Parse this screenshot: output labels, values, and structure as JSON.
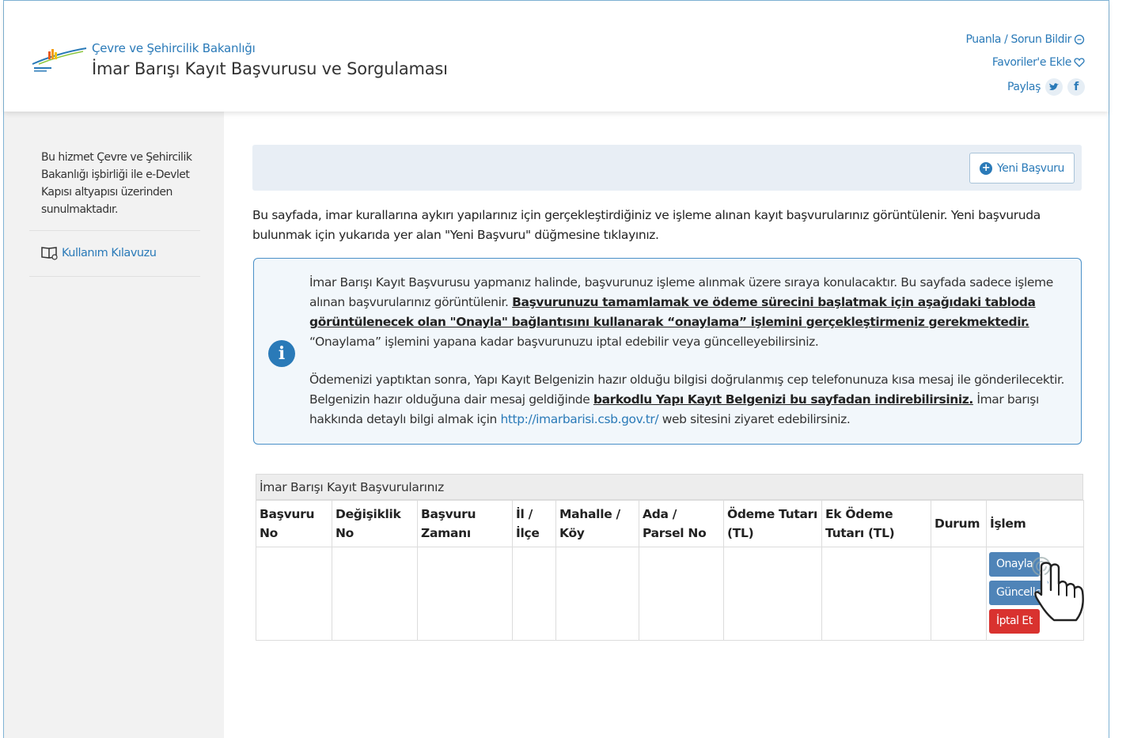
{
  "header": {
    "ministry": "Çevre ve Şehircilik Bakanlığı",
    "service_title": "İmar Barışı Kayıt Başvurusu ve Sorgulaması",
    "rate_link": "Puanla / Sorun Bildir",
    "favorites_link": "Favoriler'e Ekle",
    "share_label": "Paylaş",
    "logo_icon": "ministry-logo",
    "colors": {
      "accent": "#2a7ab8",
      "danger": "#d9322f",
      "action": "#4f84b8"
    }
  },
  "sidebar": {
    "description": "Bu hizmet Çevre ve Şehircilik Bakanlığı işbirliği ile e-Devlet Kapısı altyapısı üzerinden sunulmaktadır.",
    "guide_link": "Kullanım Kılavuzu"
  },
  "toolbar": {
    "new_application": "Yeni Başvuru"
  },
  "intro": "Bu sayfada, imar kurallarına aykırı yapılarınız için gerçekleştirdiğiniz ve işleme alınan kayıt başvurularınız görüntülenir. Yeni başvuruda bulunmak için yukarıda yer alan \"Yeni Başvuru\" düğmesine tıklayınız.",
  "info": {
    "p1_a": "İmar Barışı Kayıt Başvurusu yapmanız halinde, başvurunuz işleme alınmak üzere sıraya konulacaktır. Bu sayfada sadece işleme alınan başvurularınız görüntülenir. ",
    "p1_bold": "Başvurunuzu tamamlamak ve ödeme sürecini başlatmak için aşağıdaki tabloda görüntülenecek olan \"Onayla\" bağlantısını kullanarak “onaylama” işlemini gerçekleştirmeniz gerekmektedir.",
    "p1_c": " “Onaylama” işlemini yapana kadar başvurunuzu iptal edebilir veya güncelleyebilirsiniz.",
    "p2_a": "Ödemenizi yaptıktan sonra, Yapı Kayıt Belgenizin hazır olduğu bilgisi doğrulanmış cep telefonunuza kısa mesaj ile gönderilecektir. Belgenizin hazır olduğuna dair mesaj geldiğinde ",
    "p2_bold": "barkodlu Yapı Kayıt Belgenizi bu sayfadan indirebilirsiniz.",
    "p2_c": " İmar barışı hakkında detaylı bilgi almak için ",
    "p2_link": "http://imarbarisi.csb.gov.tr/",
    "p2_d": " web sitesini ziyaret edebilirsiniz."
  },
  "table": {
    "caption": "İmar Barışı Kayıt Başvurularınız",
    "columns": [
      "Başvuru No",
      "Değişiklik No",
      "Başvuru Zamanı",
      "İl / İlçe",
      "Mahalle / Köy",
      "Ada / Parsel No",
      "Ödeme Tutarı (TL)",
      "Ek Ödeme Tutarı (TL)",
      "Durum",
      "İşlem"
    ],
    "actions": {
      "approve": "Onayla",
      "update": "Güncelle",
      "cancel": "İptal Et"
    }
  }
}
